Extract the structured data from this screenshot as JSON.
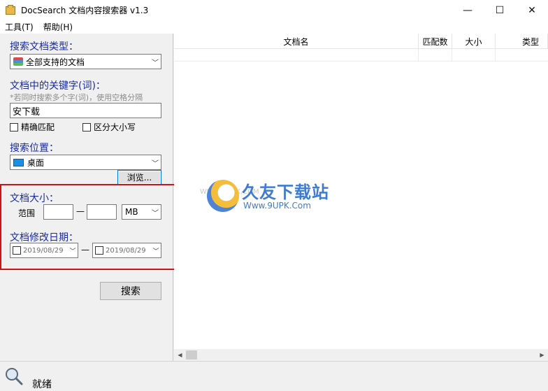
{
  "window": {
    "title": "DocSearch 文档内容搜索器 v1.3",
    "minimize": "—",
    "maximize": "☐",
    "close": "✕"
  },
  "menu": {
    "tools": "工具(T)",
    "help": "帮助(H)"
  },
  "search_panel": {
    "doc_type_label": "搜索文档类型：",
    "doc_type_value": "全部支持的文档",
    "keyword_label": "文档中的关键字(词)：",
    "keyword_hint": "*若同时搜索多个字(词)，使用空格分隔",
    "keyword_value": "安下载",
    "exact_match": "精确匹配",
    "case_sensitive": "区分大小写",
    "location_label": "搜索位置：",
    "location_value": "桌面",
    "browse_button": "浏览...",
    "size_label": "文档大小：",
    "range_label": "范围",
    "range_sep": "—",
    "size_unit": "MB",
    "date_label": "文档修改日期：",
    "date_from": "2019/08/29",
    "date_sep": "—",
    "date_to": "2019/08/29",
    "search_button": "搜索"
  },
  "list": {
    "columns": [
      "文档名",
      "匹配数",
      "大小",
      "类型"
    ]
  },
  "watermark": {
    "title": "久友下载站",
    "url": "Www.9UPK.Com",
    "faint": "WWW.9UPK.COM"
  },
  "status": {
    "text": "就绪"
  },
  "colors": {
    "label_blue": "#1a2c9c",
    "highlight_red": "#c8161d"
  }
}
